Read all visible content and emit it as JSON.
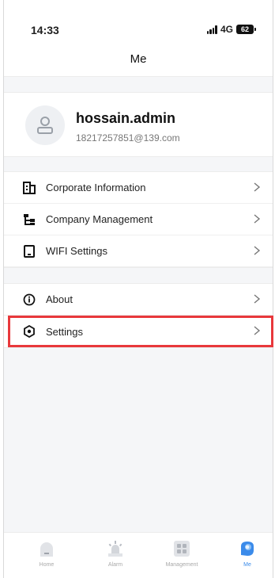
{
  "status_bar": {
    "time": "14:33",
    "network": "4G",
    "battery": "62"
  },
  "header": {
    "title": "Me"
  },
  "profile": {
    "name": "hossain.admin",
    "email": "18217257851@139.com"
  },
  "menu_group_1": [
    {
      "label": "Corporate Information",
      "icon": "building-icon"
    },
    {
      "label": "Company Management",
      "icon": "org-tree-icon"
    },
    {
      "label": "WIFI Settings",
      "icon": "device-icon"
    }
  ],
  "menu_group_2": [
    {
      "label": "About",
      "icon": "info-icon"
    },
    {
      "label": "Settings",
      "icon": "hexagon-settings-icon"
    }
  ],
  "tabs": [
    {
      "label": "Home",
      "icon": "home-icon",
      "active": false
    },
    {
      "label": "Alarm",
      "icon": "alarm-icon",
      "active": false
    },
    {
      "label": "Management",
      "icon": "grid-icon",
      "active": false
    },
    {
      "label": "Me",
      "icon": "me-icon",
      "active": true
    }
  ],
  "colors": {
    "accent": "#3b8bea",
    "highlight": "#e8383b",
    "divider": "#f5f6f8"
  }
}
